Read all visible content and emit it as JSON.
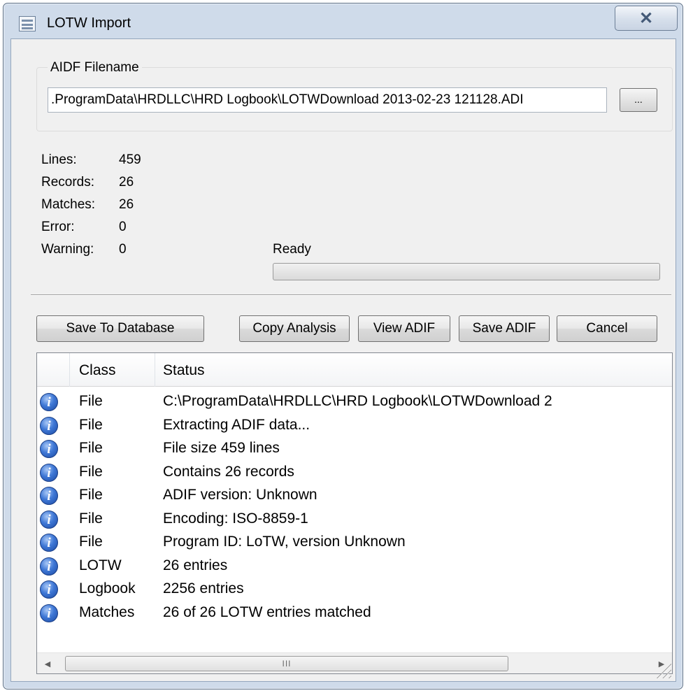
{
  "window": {
    "title": "LOTW Import",
    "close_glyph": "✕"
  },
  "file_group": {
    "label": "AIDF Filename",
    "filename_value": ".ProgramData\\HRDLLC\\HRD Logbook\\LOTWDownload 2013-02-23 121128.ADI",
    "browse_label": "..."
  },
  "stats": {
    "lines_label": "Lines:",
    "lines_value": "459",
    "records_label": "Records:",
    "records_value": "26",
    "matches_label": "Matches:",
    "matches_value": "26",
    "error_label": "Error:",
    "error_value": "0",
    "warning_label": "Warning:",
    "warning_value": "0"
  },
  "progress": {
    "status": "Ready",
    "fraction": 0
  },
  "buttons": {
    "save_to_database": "Save To Database",
    "copy_analysis": "Copy Analysis",
    "view_adif": "View ADIF",
    "save_adif": "Save ADIF",
    "cancel": "Cancel"
  },
  "log": {
    "columns": {
      "class": "Class",
      "status": "Status"
    },
    "rows": [
      {
        "icon": "info-icon",
        "class": "File",
        "status": "C:\\ProgramData\\HRDLLC\\HRD Logbook\\LOTWDownload 2"
      },
      {
        "icon": "info-icon",
        "class": "File",
        "status": "Extracting ADIF data..."
      },
      {
        "icon": "info-icon",
        "class": "File",
        "status": "File size 459 lines"
      },
      {
        "icon": "info-icon",
        "class": "File",
        "status": "Contains 26 records"
      },
      {
        "icon": "info-icon",
        "class": "File",
        "status": "ADIF version: Unknown"
      },
      {
        "icon": "info-icon",
        "class": "File",
        "status": "Encoding:   ISO-8859-1"
      },
      {
        "icon": "info-icon",
        "class": "File",
        "status": "Program ID:  LoTW, version Unknown"
      },
      {
        "icon": "info-icon",
        "class": "LOTW",
        "status": "26 entries"
      },
      {
        "icon": "info-icon",
        "class": "Logbook",
        "status": "2256 entries"
      },
      {
        "icon": "info-icon",
        "class": "Matches",
        "status": "26 of 26 LOTW entries matched"
      }
    ],
    "scroll": {
      "left_arrow": "◀",
      "right_arrow": "▶",
      "grip": "III"
    }
  },
  "colors": {
    "frame": "#cfdbea",
    "client": "#f0f0f0",
    "info_icon": "#3f78d6"
  }
}
